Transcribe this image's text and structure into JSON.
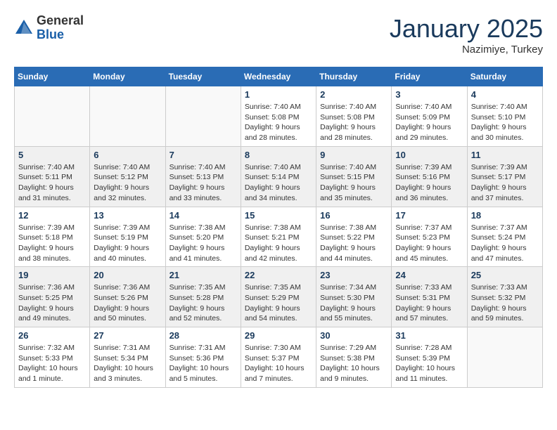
{
  "header": {
    "logo_general": "General",
    "logo_blue": "Blue",
    "month": "January 2025",
    "location": "Nazimiye, Turkey"
  },
  "days_of_week": [
    "Sunday",
    "Monday",
    "Tuesday",
    "Wednesday",
    "Thursday",
    "Friday",
    "Saturday"
  ],
  "weeks": [
    {
      "shade": false,
      "days": [
        {
          "num": "",
          "info": ""
        },
        {
          "num": "",
          "info": ""
        },
        {
          "num": "",
          "info": ""
        },
        {
          "num": "1",
          "info": "Sunrise: 7:40 AM\nSunset: 5:08 PM\nDaylight: 9 hours\nand 28 minutes."
        },
        {
          "num": "2",
          "info": "Sunrise: 7:40 AM\nSunset: 5:08 PM\nDaylight: 9 hours\nand 28 minutes."
        },
        {
          "num": "3",
          "info": "Sunrise: 7:40 AM\nSunset: 5:09 PM\nDaylight: 9 hours\nand 29 minutes."
        },
        {
          "num": "4",
          "info": "Sunrise: 7:40 AM\nSunset: 5:10 PM\nDaylight: 9 hours\nand 30 minutes."
        }
      ]
    },
    {
      "shade": true,
      "days": [
        {
          "num": "5",
          "info": "Sunrise: 7:40 AM\nSunset: 5:11 PM\nDaylight: 9 hours\nand 31 minutes."
        },
        {
          "num": "6",
          "info": "Sunrise: 7:40 AM\nSunset: 5:12 PM\nDaylight: 9 hours\nand 32 minutes."
        },
        {
          "num": "7",
          "info": "Sunrise: 7:40 AM\nSunset: 5:13 PM\nDaylight: 9 hours\nand 33 minutes."
        },
        {
          "num": "8",
          "info": "Sunrise: 7:40 AM\nSunset: 5:14 PM\nDaylight: 9 hours\nand 34 minutes."
        },
        {
          "num": "9",
          "info": "Sunrise: 7:40 AM\nSunset: 5:15 PM\nDaylight: 9 hours\nand 35 minutes."
        },
        {
          "num": "10",
          "info": "Sunrise: 7:39 AM\nSunset: 5:16 PM\nDaylight: 9 hours\nand 36 minutes."
        },
        {
          "num": "11",
          "info": "Sunrise: 7:39 AM\nSunset: 5:17 PM\nDaylight: 9 hours\nand 37 minutes."
        }
      ]
    },
    {
      "shade": false,
      "days": [
        {
          "num": "12",
          "info": "Sunrise: 7:39 AM\nSunset: 5:18 PM\nDaylight: 9 hours\nand 38 minutes."
        },
        {
          "num": "13",
          "info": "Sunrise: 7:39 AM\nSunset: 5:19 PM\nDaylight: 9 hours\nand 40 minutes."
        },
        {
          "num": "14",
          "info": "Sunrise: 7:38 AM\nSunset: 5:20 PM\nDaylight: 9 hours\nand 41 minutes."
        },
        {
          "num": "15",
          "info": "Sunrise: 7:38 AM\nSunset: 5:21 PM\nDaylight: 9 hours\nand 42 minutes."
        },
        {
          "num": "16",
          "info": "Sunrise: 7:38 AM\nSunset: 5:22 PM\nDaylight: 9 hours\nand 44 minutes."
        },
        {
          "num": "17",
          "info": "Sunrise: 7:37 AM\nSunset: 5:23 PM\nDaylight: 9 hours\nand 45 minutes."
        },
        {
          "num": "18",
          "info": "Sunrise: 7:37 AM\nSunset: 5:24 PM\nDaylight: 9 hours\nand 47 minutes."
        }
      ]
    },
    {
      "shade": true,
      "days": [
        {
          "num": "19",
          "info": "Sunrise: 7:36 AM\nSunset: 5:25 PM\nDaylight: 9 hours\nand 49 minutes."
        },
        {
          "num": "20",
          "info": "Sunrise: 7:36 AM\nSunset: 5:26 PM\nDaylight: 9 hours\nand 50 minutes."
        },
        {
          "num": "21",
          "info": "Sunrise: 7:35 AM\nSunset: 5:28 PM\nDaylight: 9 hours\nand 52 minutes."
        },
        {
          "num": "22",
          "info": "Sunrise: 7:35 AM\nSunset: 5:29 PM\nDaylight: 9 hours\nand 54 minutes."
        },
        {
          "num": "23",
          "info": "Sunrise: 7:34 AM\nSunset: 5:30 PM\nDaylight: 9 hours\nand 55 minutes."
        },
        {
          "num": "24",
          "info": "Sunrise: 7:33 AM\nSunset: 5:31 PM\nDaylight: 9 hours\nand 57 minutes."
        },
        {
          "num": "25",
          "info": "Sunrise: 7:33 AM\nSunset: 5:32 PM\nDaylight: 9 hours\nand 59 minutes."
        }
      ]
    },
    {
      "shade": false,
      "days": [
        {
          "num": "26",
          "info": "Sunrise: 7:32 AM\nSunset: 5:33 PM\nDaylight: 10 hours\nand 1 minute."
        },
        {
          "num": "27",
          "info": "Sunrise: 7:31 AM\nSunset: 5:34 PM\nDaylight: 10 hours\nand 3 minutes."
        },
        {
          "num": "28",
          "info": "Sunrise: 7:31 AM\nSunset: 5:36 PM\nDaylight: 10 hours\nand 5 minutes."
        },
        {
          "num": "29",
          "info": "Sunrise: 7:30 AM\nSunset: 5:37 PM\nDaylight: 10 hours\nand 7 minutes."
        },
        {
          "num": "30",
          "info": "Sunrise: 7:29 AM\nSunset: 5:38 PM\nDaylight: 10 hours\nand 9 minutes."
        },
        {
          "num": "31",
          "info": "Sunrise: 7:28 AM\nSunset: 5:39 PM\nDaylight: 10 hours\nand 11 minutes."
        },
        {
          "num": "",
          "info": ""
        }
      ]
    }
  ]
}
